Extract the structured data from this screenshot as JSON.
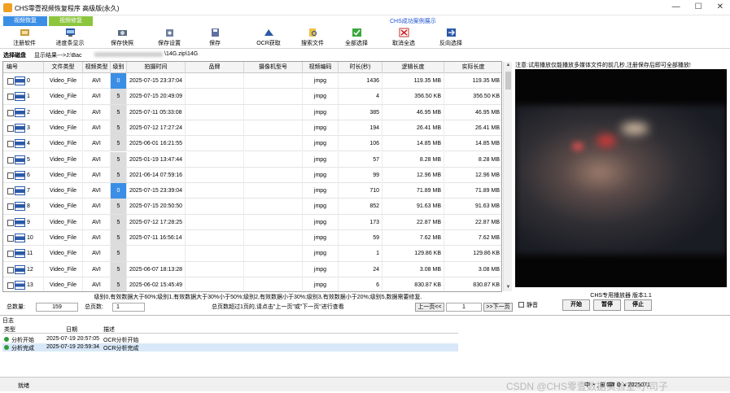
{
  "app": {
    "title": "CHS零壹视频恢复程序 高级版(永久)"
  },
  "tabs": [
    {
      "label": "视频恢复"
    },
    {
      "label": "视频修复"
    }
  ],
  "case_link": "CHS成功案例展示",
  "toolbar": [
    {
      "label": "注册软件",
      "icon": "register-icon"
    },
    {
      "label": "进度条显示",
      "icon": "progress-icon"
    },
    {
      "label": "保存快照",
      "icon": "snapshot-icon"
    },
    {
      "label": "保存设置",
      "icon": "settings-save-icon"
    },
    {
      "label": "保存",
      "icon": "save-icon"
    },
    {
      "label": "OCR获取",
      "icon": "ocr-icon"
    },
    {
      "label": "搜索文件",
      "icon": "search-file-icon"
    },
    {
      "label": "全部选择",
      "icon": "select-all-icon"
    },
    {
      "label": "取消全选",
      "icon": "cancel-select-icon"
    },
    {
      "label": "反向选择",
      "icon": "invert-select-icon"
    }
  ],
  "path": {
    "select_disk": "选择磁盘",
    "result_label": "显示结果--->J:\\Bac",
    "result_tail": "\\14G.zip\\14G"
  },
  "table": {
    "columns": [
      "编号",
      "文件类型",
      "视频类型",
      "级别",
      "拍摄时间",
      "品牌",
      "摄像机型号",
      "视频编码",
      "时长(秒)",
      "逻辑长度",
      "实际长度"
    ],
    "rows": [
      {
        "num": "0",
        "ftype": "Video_File",
        "vtype": "AVI",
        "level": "0",
        "time": "2025-07-15 23:37:04",
        "brand": "",
        "model": "",
        "codec": "jmpg",
        "duration": "1436",
        "logical": "119.35 MB",
        "actual": "119.35 MB"
      },
      {
        "num": "1",
        "ftype": "Video_File",
        "vtype": "AVI",
        "level": "5",
        "time": "2025-07-15 20:49:09",
        "brand": "",
        "model": "",
        "codec": "jmpg",
        "duration": "4",
        "logical": "356.50 KB",
        "actual": "356.50 KB"
      },
      {
        "num": "2",
        "ftype": "Video_File",
        "vtype": "AVI",
        "level": "5",
        "time": "2025-07-11 05:33:08",
        "brand": "",
        "model": "",
        "codec": "jmpg",
        "duration": "385",
        "logical": "46.95 MB",
        "actual": "46.95 MB"
      },
      {
        "num": "3",
        "ftype": "Video_File",
        "vtype": "AVI",
        "level": "5",
        "time": "2025-07-12 17:27:24",
        "brand": "",
        "model": "",
        "codec": "jmpg",
        "duration": "194",
        "logical": "26.41 MB",
        "actual": "26.41 MB"
      },
      {
        "num": "4",
        "ftype": "Video_File",
        "vtype": "AVI",
        "level": "5",
        "time": "2025-06-01 16:21:55",
        "brand": "",
        "model": "",
        "codec": "jmpg",
        "duration": "106",
        "logical": "14.85 MB",
        "actual": "14.85 MB"
      },
      {
        "num": "5",
        "ftype": "Video_File",
        "vtype": "AVI",
        "level": "5",
        "time": "2025-01-19 13:47:44",
        "brand": "",
        "model": "",
        "codec": "jmpg",
        "duration": "57",
        "logical": "8.28 MB",
        "actual": "8.28 MB"
      },
      {
        "num": "6",
        "ftype": "Video_File",
        "vtype": "AVI",
        "level": "5",
        "time": "2021-06-14 07:59:16",
        "brand": "",
        "model": "",
        "codec": "jmpg",
        "duration": "99",
        "logical": "12.96 MB",
        "actual": "12.96 MB"
      },
      {
        "num": "7",
        "ftype": "Video_File",
        "vtype": "AVI",
        "level": "0",
        "time": "2025-07-15 23:39:04",
        "brand": "",
        "model": "",
        "codec": "jmpg",
        "duration": "710",
        "logical": "71.89 MB",
        "actual": "71.89 MB"
      },
      {
        "num": "8",
        "ftype": "Video_File",
        "vtype": "AVI",
        "level": "5",
        "time": "2025-07-15 20:50:50",
        "brand": "",
        "model": "",
        "codec": "jmpg",
        "duration": "852",
        "logical": "91.63 MB",
        "actual": "91.63 MB"
      },
      {
        "num": "9",
        "ftype": "Video_File",
        "vtype": "AVI",
        "level": "5",
        "time": "2025-07-12 17:28:25",
        "brand": "",
        "model": "",
        "codec": "jmpg",
        "duration": "173",
        "logical": "22.87 MB",
        "actual": "22.87 MB"
      },
      {
        "num": "10",
        "ftype": "Video_File",
        "vtype": "AVI",
        "level": "5",
        "time": "2025-07-11 16:56:14",
        "brand": "",
        "model": "",
        "codec": "jmpg",
        "duration": "59",
        "logical": "7.62 MB",
        "actual": "7.62 MB"
      },
      {
        "num": "11",
        "ftype": "Video_File",
        "vtype": "AVI",
        "level": "5",
        "time": "",
        "brand": "",
        "model": "",
        "codec": "jmpg",
        "duration": "1",
        "logical": "129.86 KB",
        "actual": "129.86 KB"
      },
      {
        "num": "12",
        "ftype": "Video_File",
        "vtype": "AVI",
        "level": "5",
        "time": "2025-06-07 18:13:28",
        "brand": "",
        "model": "",
        "codec": "jmpg",
        "duration": "24",
        "logical": "3.08 MB",
        "actual": "3.08 MB"
      },
      {
        "num": "13",
        "ftype": "Video_File",
        "vtype": "AVI",
        "level": "5",
        "time": "2025-06-02 15:45:49",
        "brand": "",
        "model": "",
        "codec": "jmpg",
        "duration": "6",
        "logical": "830.87 KB",
        "actual": "830.87 KB"
      }
    ]
  },
  "level_note": "级别0,有效数据大于60%;级别1,有效数据大于30%小于50%;级别2,有效数据小于30%;级别3,有效数据小于20%;级别5,数据需要修复.",
  "pager": {
    "total_label": "总数量:",
    "total": "159",
    "pages_label": "总页数:",
    "pages": "1",
    "hint": "总页数超过1页的,请点击\"上一页\"或\"下一页\"进行查看",
    "prev": "上一页<<",
    "current": "1",
    "next": ">>下一页"
  },
  "player": {
    "notice": "注意:试用播放仅能播放多媒体文件的前几秒,注册保存后即可全部播放!",
    "version": "CHS专用播放器 版本1.1",
    "mute": "静音",
    "play": "开始",
    "pause": "暂停",
    "stop": "停止"
  },
  "log": {
    "title": "日志",
    "columns": [
      "类型",
      "日期",
      "描述"
    ],
    "rows": [
      {
        "type": "分析开始",
        "date": "2025-07-19 20:57:05",
        "desc": "OCR分析开始"
      },
      {
        "type": "分析完成",
        "date": "2025-07-19 20:59:34",
        "desc": "OCR分析完成"
      }
    ]
  },
  "status": {
    "text": "就绪",
    "ime": "中 ◔ ¸ ⊞ ⌨ ⚙ ⚹ 2025071",
    "watermark": "CSDN @CHS零壹数据实验室-小司子"
  },
  "colors": {
    "accent": "#3a8ee6",
    "tab_green": "#8cc63f",
    "link": "#1a4fd0"
  }
}
